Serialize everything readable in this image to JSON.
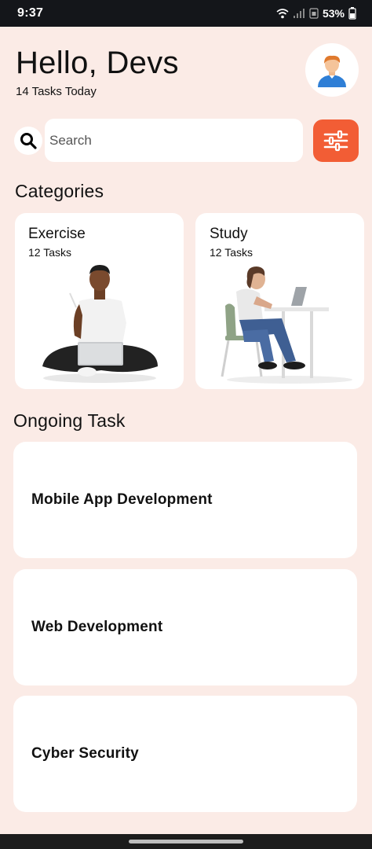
{
  "status_bar": {
    "time": "9:37",
    "battery": "53%"
  },
  "header": {
    "greeting": "Hello, Devs",
    "subtitle": "14 Tasks Today"
  },
  "search": {
    "placeholder": "Search"
  },
  "categories": {
    "title": "Categories",
    "items": [
      {
        "title": "Exercise",
        "count": "12 Tasks"
      },
      {
        "title": "Study",
        "count": "12 Tasks"
      }
    ]
  },
  "ongoing": {
    "title": "Ongoing Task",
    "tasks": [
      {
        "label": "Mobile App Development"
      },
      {
        "label": "Web Development"
      },
      {
        "label": "Cyber Security"
      }
    ]
  },
  "colors": {
    "background": "#fbebe6",
    "accent": "#f25d35",
    "card": "#ffffff",
    "status_bar": "#14161a"
  }
}
